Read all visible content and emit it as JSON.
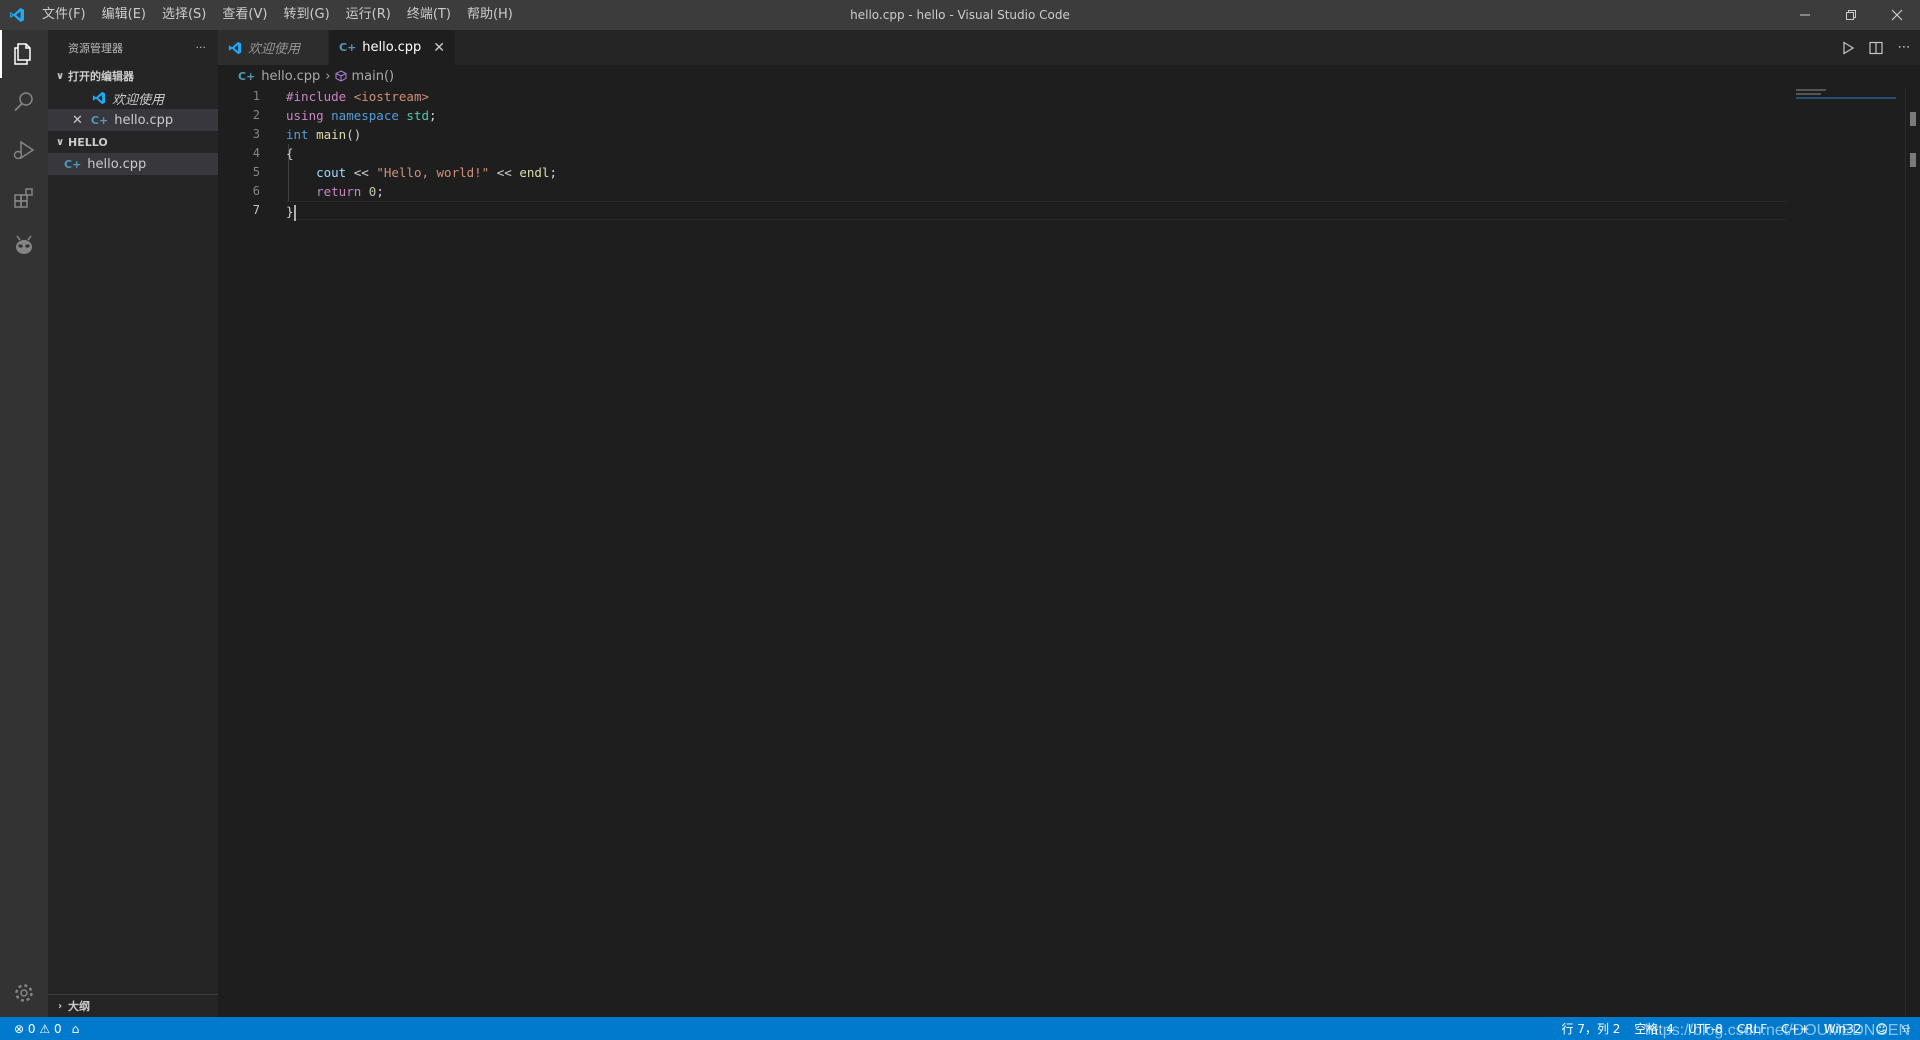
{
  "window": {
    "title": "hello.cpp - hello - Visual Studio Code",
    "menu": [
      "文件(F)",
      "编辑(E)",
      "选择(S)",
      "查看(V)",
      "转到(G)",
      "运行(R)",
      "终端(T)",
      "帮助(H)"
    ]
  },
  "sidebar": {
    "header": "资源管理器",
    "more": "···",
    "open_editors_label": "打开的编辑器",
    "open_editors": [
      {
        "label": "欢迎使用"
      },
      {
        "label": "hello.cpp",
        "icon_text": "C+"
      }
    ],
    "folder_label": "HELLO",
    "folder_files": [
      {
        "label": "hello.cpp",
        "icon_text": "C+"
      }
    ],
    "outline_label": "大纲"
  },
  "tabs": [
    {
      "label": "欢迎使用"
    },
    {
      "label": "hello.cpp",
      "icon_text": "C+"
    }
  ],
  "breadcrumb": {
    "file": "hello.cpp",
    "symbol": "main()"
  },
  "editor": {
    "line_numbers": [
      "1",
      "2",
      "3",
      "4",
      "5",
      "6",
      "7"
    ],
    "active_line": 7,
    "code": [
      {
        "tokens": [
          {
            "t": "#include ",
            "c": "kw-pink"
          },
          {
            "t": "<iostream>",
            "c": "str"
          }
        ]
      },
      {
        "tokens": [
          {
            "t": "using ",
            "c": "kw-pink"
          },
          {
            "t": "namespace ",
            "c": "kw-blue"
          },
          {
            "t": "std",
            "c": "type"
          },
          {
            "t": ";",
            "c": ""
          }
        ]
      },
      {
        "tokens": [
          {
            "t": "int ",
            "c": "kw-blue"
          },
          {
            "t": "main",
            "c": "fn"
          },
          {
            "t": "()",
            "c": ""
          }
        ]
      },
      {
        "tokens": [
          {
            "t": "{",
            "c": ""
          }
        ]
      },
      {
        "tokens": [
          {
            "t": "    ",
            "c": ""
          },
          {
            "t": "cout",
            "c": "var"
          },
          {
            "t": " << ",
            "c": ""
          },
          {
            "t": "\"Hello, world!\"",
            "c": "str"
          },
          {
            "t": " << ",
            "c": ""
          },
          {
            "t": "endl",
            "c": "fn"
          },
          {
            "t": ";",
            "c": ""
          }
        ]
      },
      {
        "tokens": [
          {
            "t": "    ",
            "c": ""
          },
          {
            "t": "return ",
            "c": "ctrl"
          },
          {
            "t": "0",
            "c": "num"
          },
          {
            "t": ";",
            "c": ""
          }
        ]
      },
      {
        "tokens": [
          {
            "t": "}",
            "c": ""
          }
        ]
      }
    ]
  },
  "statusbar": {
    "errors": "0",
    "warnings": "0",
    "position": "行 7，列 2",
    "spaces": "空格: 4",
    "encoding": "UTF-8",
    "eol": "CRLF",
    "language": "C++",
    "platform": "Win32",
    "watermark": "https://blog.csdn.net/DOUMEDNGEN"
  },
  "colors": {
    "accent": "#007acc",
    "titlebar": "#3c3c3c",
    "sidebar": "#252526",
    "editor": "#1e1e1e"
  }
}
